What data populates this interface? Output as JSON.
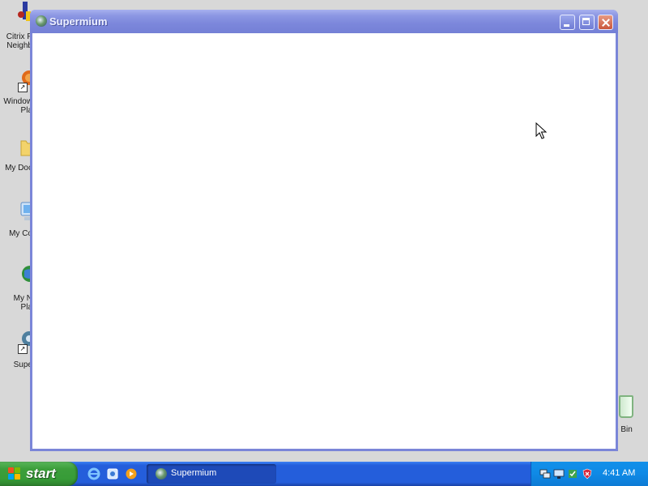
{
  "desktop": {
    "icons": [
      {
        "label": "Citrix P\nNeighb",
        "icon": "citrix-icon"
      },
      {
        "label": "Window\nPla",
        "icon": "media-player-icon"
      },
      {
        "label": "My Doc",
        "icon": "folder-icon"
      },
      {
        "label": "My Co",
        "icon": "computer-icon"
      },
      {
        "label": "My N\nPla",
        "icon": "network-icon"
      },
      {
        "label": "Supe",
        "icon": "supermium-icon"
      }
    ],
    "recycle_bin": {
      "label": "e Bin",
      "icon": "recycle-bin-icon"
    }
  },
  "window": {
    "title": "Supermium",
    "icon": "supermium-icon",
    "buttons": [
      "minimize-icon",
      "maximize-icon",
      "close-icon"
    ]
  },
  "taskbar": {
    "start_label": "start",
    "quick_launch": [
      "internet-explorer-icon",
      "browser-icon",
      "media-player-icon"
    ],
    "tasks": [
      {
        "label": "Supermium",
        "icon": "supermium-icon"
      }
    ],
    "tray_icons": [
      "network-icon",
      "monitor-icon",
      "security-icon",
      "shield-icon"
    ],
    "clock": "4:41 AM"
  }
}
